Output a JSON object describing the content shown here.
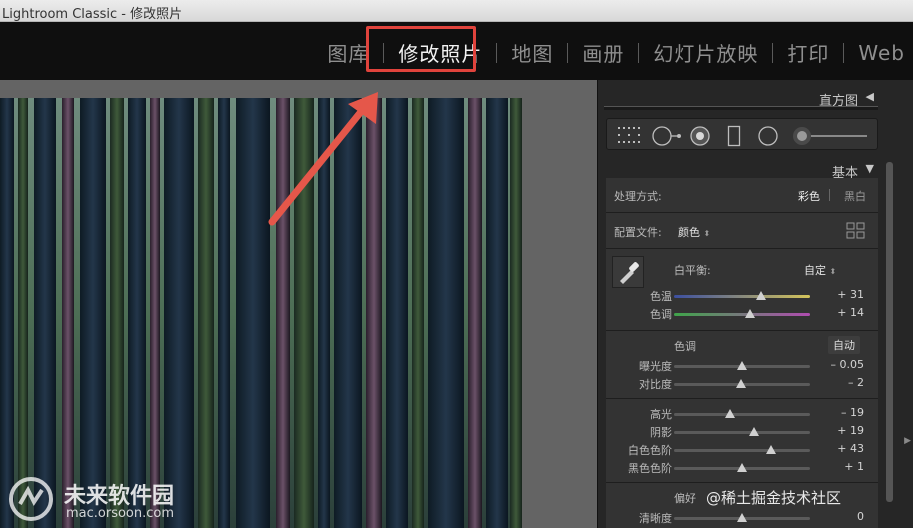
{
  "window": {
    "title": "Lightroom Classic - 修改照片"
  },
  "modules": [
    {
      "label": "图库",
      "active": false
    },
    {
      "label": "修改照片",
      "active": true
    },
    {
      "label": "地图",
      "active": false
    },
    {
      "label": "画册",
      "active": false
    },
    {
      "label": "幻灯片放映",
      "active": false
    },
    {
      "label": "打印",
      "active": false
    },
    {
      "label": "Web",
      "active": false
    }
  ],
  "panels": {
    "histogram": {
      "label": "直方图",
      "triangle": "◀"
    },
    "basic": {
      "label": "基本",
      "triangle": "▼"
    }
  },
  "basic": {
    "treatment": {
      "label": "处理方式:",
      "color_option": "彩色",
      "bw_option": "黑白"
    },
    "profile": {
      "label": "配置文件:",
      "value": "颜色"
    },
    "white_balance": {
      "label": "白平衡:",
      "value": "自定"
    },
    "temp": {
      "label": "色温",
      "value": "+ 31",
      "position": 0.64
    },
    "tint": {
      "label": "色调",
      "value": "+ 14",
      "position": 0.56
    },
    "tone": {
      "label": "色调",
      "auto": "自动"
    },
    "exposure": {
      "label": "曝光度",
      "value": "– 0.05",
      "position": 0.5
    },
    "contrast": {
      "label": "对比度",
      "value": "– 2",
      "position": 0.49
    },
    "highlights": {
      "label": "高光",
      "value": "– 19",
      "position": 0.41
    },
    "shadows": {
      "label": "阴影",
      "value": "+ 19",
      "position": 0.59
    },
    "whites": {
      "label": "白色色阶",
      "value": "+ 43",
      "position": 0.71
    },
    "blacks": {
      "label": "黑色色阶",
      "value": "+ 1",
      "position": 0.5
    },
    "presence": {
      "label": "偏好"
    },
    "clarity": {
      "label": "清晰度",
      "value": "0",
      "position": 0.5
    }
  },
  "watermarks": {
    "left_brand": "未来软件园",
    "left_url": "mac.orsoon.com",
    "right": "@稀土掘金技术社区"
  },
  "colors": {
    "highlight_box": "#e0433c",
    "arrow": "#e5574a"
  }
}
